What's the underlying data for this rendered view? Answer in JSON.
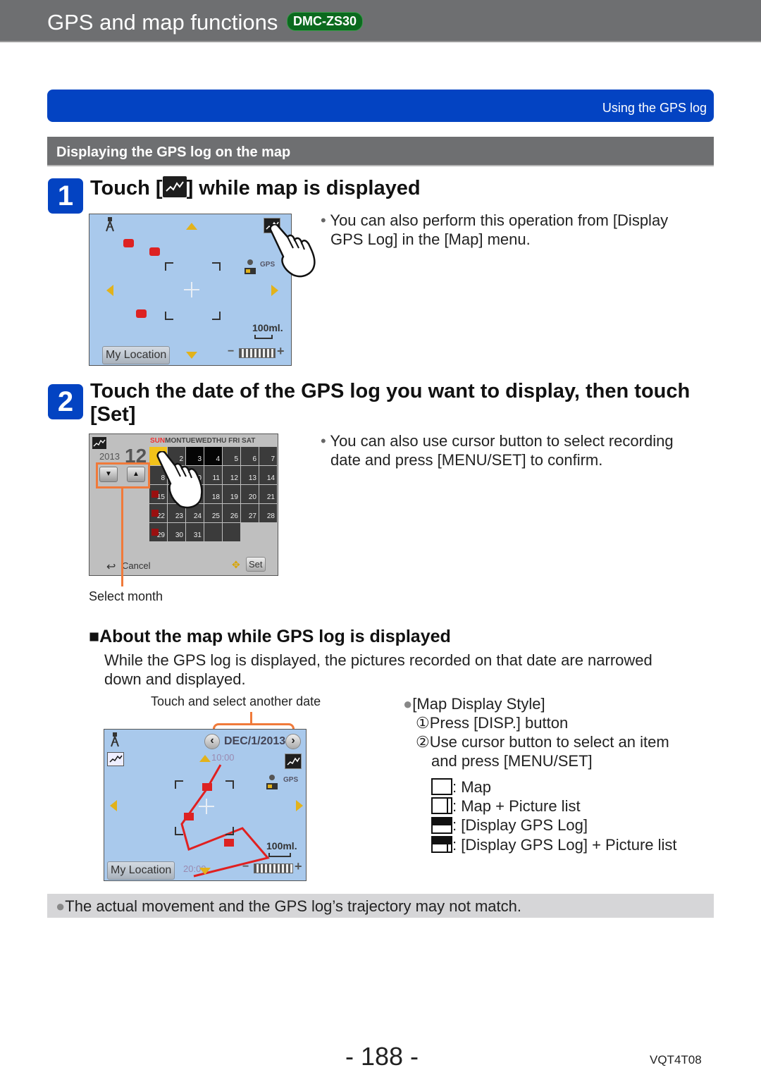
{
  "header": {
    "title": "GPS and map functions",
    "model_badge": "DMC-ZS30"
  },
  "section_bar": {
    "label": "Using the GPS log"
  },
  "subsection": {
    "title": "Displaying the GPS log on the map"
  },
  "steps": [
    {
      "number": "1",
      "title_before_icon": "Touch [",
      "icon": "gps-log-icon",
      "title_after_icon": "] while map is displayed",
      "note_bullet": "•",
      "note_line1": "You can also perform this operation from [Display",
      "note_line2": "GPS Log] in the [Map] menu."
    },
    {
      "number": "2",
      "title_line1": "Touch the date of the GPS log you want to display, then touch",
      "title_line2": "[Set]",
      "note_bullet": "•",
      "note_line1": "You can also use cursor button to select recording",
      "note_line2": "date and press [MENU/SET] to confirm."
    }
  ],
  "screen1": {
    "my_location_button": "My Location",
    "scale": "100ml."
  },
  "calendar_screen": {
    "year": "2013",
    "month": "12",
    "weekdays": [
      "SUN",
      "MON",
      "TUE",
      "WED",
      "THU",
      "FRI",
      "SAT"
    ],
    "days": [
      "1",
      "2",
      "3",
      "4",
      "5",
      "6",
      "7",
      "8",
      "9",
      "10",
      "11",
      "12",
      "13",
      "14",
      "15",
      "16",
      "17",
      "18",
      "19",
      "20",
      "21",
      "22",
      "23",
      "24",
      "25",
      "26",
      "27",
      "28",
      "29",
      "30",
      "31"
    ],
    "selected_day": "1",
    "cancel_label": "Cancel",
    "set_label": "Set",
    "callout_caption": "Select month"
  },
  "about_section": {
    "marker": "■",
    "heading": "About the map while GPS log is displayed",
    "paragraph_line1": "While the GPS log is displayed, the pictures recorded on that date are narrowed",
    "paragraph_line2": "down and displayed.",
    "callout_caption": "Touch and select another date"
  },
  "screen3": {
    "date": "DEC/1/2013",
    "start_time": "10:00",
    "end_time": "20:00",
    "scale": "100ml.",
    "my_location_button": "My Location",
    "prev_date_button": "‹",
    "next_date_button": "›"
  },
  "map_display_style": {
    "bullet": "●",
    "title": "[Map Display Style]",
    "step1": "①Press [DISP.] button",
    "step2_line1": "②Use cursor button to select an item",
    "step2_line2": "and press [MENU/SET]",
    "options": [
      {
        "icon": "map-icon",
        "label": ": Map"
      },
      {
        "icon": "map-picture-list-icon",
        "label": ": Map + Picture list"
      },
      {
        "icon": "display-gps-log-icon",
        "label": ": [Display GPS Log]"
      },
      {
        "icon": "display-gps-log-picture-list-icon",
        "label": ": [Display GPS Log] + Picture list"
      }
    ]
  },
  "note": {
    "bullet": "●",
    "text": "The actual movement and the GPS log’s trajectory may not match."
  },
  "footer": {
    "page_number": "- 188 -",
    "doc_code": "VQT4T08"
  },
  "colors": {
    "header_gray": "#6e6f71",
    "section_blue": "#0343c2",
    "badge_green": "#0b6a1e",
    "callout_orange": "#f07a3a",
    "note_gray": "#d6d6d8"
  }
}
